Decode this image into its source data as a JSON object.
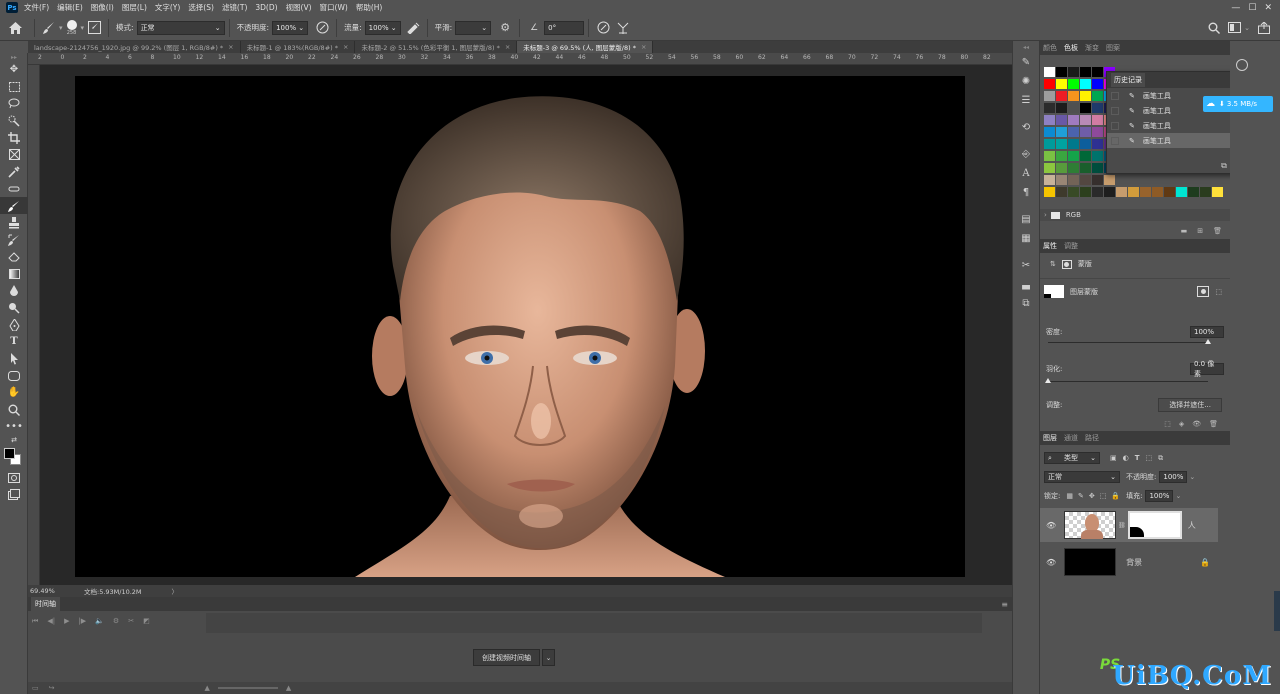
{
  "menubar": {
    "logo": "Ps",
    "items": [
      "文件(F)",
      "编辑(E)",
      "图像(I)",
      "图层(L)",
      "文字(Y)",
      "选择(S)",
      "滤镜(T)",
      "3D(D)",
      "视图(V)",
      "窗口(W)",
      "帮助(H)"
    ]
  },
  "options": {
    "brush_size": "258",
    "mode_label": "模式:",
    "mode_value": "正常",
    "opacity_label": "不透明度:",
    "opacity_value": "100%",
    "flow_label": "流量:",
    "flow_value": "100%",
    "smooth_label": "平滑:",
    "smooth_value": "",
    "angle_value": "0°"
  },
  "tabs": [
    {
      "label": "landscape-2124756_1920.jpg @ 99.2% (图层 1, RGB/8#) *"
    },
    {
      "label": "未标题-1 @ 183%(RGB/8#) *"
    },
    {
      "label": "未标题-2 @ 51.5% (色彩平衡 1, 图层蒙版/8) *"
    },
    {
      "label": "未标题-3 @ 69.5% (人, 图层蒙版/8) *"
    }
  ],
  "ruler_ticks": [
    "2",
    "0",
    "2",
    "4",
    "6",
    "8",
    "10",
    "12",
    "14",
    "16",
    "18",
    "20",
    "22",
    "24",
    "26",
    "28",
    "30",
    "32",
    "34",
    "36",
    "38",
    "40",
    "42",
    "44",
    "46",
    "48",
    "50",
    "52",
    "54",
    "56",
    "58",
    "60",
    "62",
    "64",
    "66",
    "68",
    "70",
    "72",
    "74",
    "76",
    "78",
    "80",
    "82"
  ],
  "status": {
    "zoom": "69.49%",
    "doc": "文档:5.93M/10.2M"
  },
  "timeline": {
    "title": "时间轴",
    "create_button": "创建视频时间轴"
  },
  "swatches_panel": {
    "tabs": [
      "颜色",
      "色板",
      "渐变",
      "图案"
    ],
    "active_tab": "色板",
    "group_label": "RGB"
  },
  "swatch_rows": [
    [
      "#ffffff",
      "#000000",
      "#1a1a1a",
      "#000000",
      "#000000",
      "#8a00ff"
    ],
    [
      "#ff0000",
      "#ffff00",
      "#00ff00",
      "#00ffff",
      "#0000ff",
      "#ff00ff"
    ],
    [
      "#9e9e9e",
      "#ed1c24",
      "#f7941d",
      "#fff200",
      "#00a651",
      "#00aeef"
    ],
    [
      "#2b2b2b",
      "#1c1c1c",
      "#505050",
      "#000000",
      "#1f3a6b",
      "#1d1d58"
    ],
    [
      "#8e81c3",
      "#6958a6",
      "#a07bbf",
      "#b88ab6",
      "#d17ca3",
      "#ee8a8a"
    ],
    [
      "#0c8bd1",
      "#1f9fd8",
      "#4b63ad",
      "#6f5da8",
      "#8e4a9b",
      "#c34a8a"
    ],
    [
      "#009b9b",
      "#00a3a0",
      "#00798c",
      "#0c5e9c",
      "#2e3192",
      "#662d91"
    ],
    [
      "#7ac143",
      "#3aa640",
      "#15a34a",
      "#006838",
      "#00736c",
      "#005b7f"
    ],
    [
      "#8cc63f",
      "#589b3c",
      "#2f7d35",
      "#1a5e2c",
      "#004d3d",
      "#00415a"
    ],
    [
      "#c7b299",
      "#998675",
      "#736357",
      "#534741",
      "#362f2d",
      "#c69c6d"
    ],
    [
      "#f5c400",
      "#3e3a2c",
      "#384a26",
      "#2c3f1d",
      "#2a2a2a",
      "#1e1e1e"
    ]
  ],
  "swatch_extra_row": [
    "#c69c6d",
    "#a67c52",
    "#8c6239",
    "#754c24",
    "#603913",
    "#00ffcc",
    "#0b3f33",
    "#1a3a1a",
    "#f0e000"
  ],
  "swatch_extra_row2": [
    "#c69c6d",
    "#d29c3b",
    "#98632c",
    "#8e5b26",
    "#603913",
    "#00e6d2",
    "#1e3c1e",
    "#2a3c1e",
    "#ffe13a"
  ],
  "history": {
    "title": "历史记录",
    "items": [
      "画笔工具",
      "画笔工具",
      "画笔工具",
      "画笔工具"
    ],
    "selected_index": 3
  },
  "speed_badge": "3.5 MB/s",
  "properties": {
    "tabs": [
      "属性",
      "调整"
    ],
    "mask_label": "蒙版",
    "layer_mask_label": "图层蒙版",
    "density_label": "密度:",
    "density_value": "100%",
    "density": 1.0,
    "feather_label": "羽化:",
    "feather_value": "0.0 像素",
    "feather": 0.0,
    "adjust_label": "调整:",
    "select_mask_button": "选择并遮住..."
  },
  "layers_panel": {
    "tabs": [
      "图层",
      "通道",
      "路径"
    ],
    "filter_label": "类型",
    "blend_mode": "正常",
    "opacity_label": "不透明度:",
    "opacity_value": "100%",
    "lock_label": "锁定:",
    "fill_label": "填充:",
    "fill_value": "100%",
    "layers": [
      {
        "name": "人",
        "selected": true
      },
      {
        "name": "背景",
        "selected": false
      }
    ]
  },
  "watermark": {
    "ps": "PS",
    "brand": "UiBQ.CoM"
  },
  "colors": {
    "ui_bg": "#535353",
    "panel_dark": "#3b3b3b",
    "canvas_bg": "#282828",
    "accent": "#34b6ff"
  }
}
